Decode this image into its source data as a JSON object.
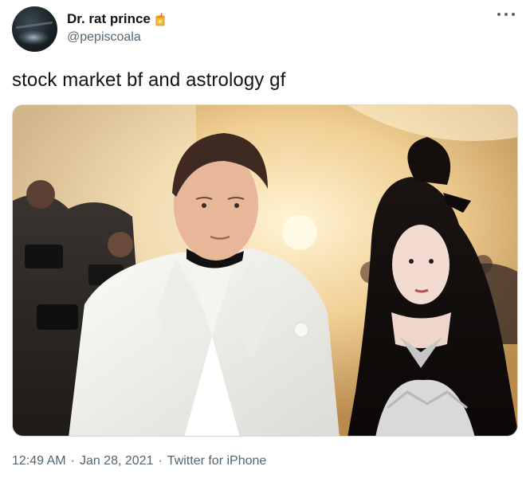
{
  "author": {
    "display_name": "Dr. rat prince",
    "handle": "@pepiscoala",
    "badge_icon": "juice-box-icon"
  },
  "tweet": {
    "text": "stock market bf and astrology gf"
  },
  "media": {
    "subject_left": "man in white tuxedo",
    "subject_right": "woman with long dark hair"
  },
  "meta": {
    "time": "12:49 AM",
    "separator": "·",
    "date": "Jan 28, 2021",
    "client": "Twitter for iPhone"
  },
  "colors": {
    "text": "#0f1419",
    "secondary": "#536471"
  },
  "icons": {
    "more": "more-options-icon"
  }
}
